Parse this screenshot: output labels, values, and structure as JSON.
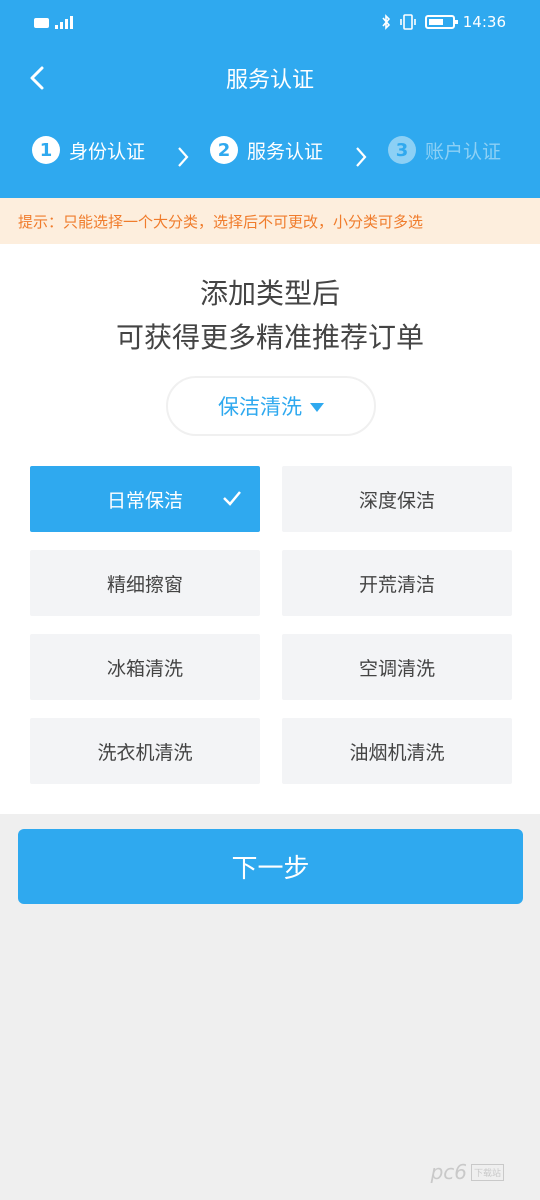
{
  "status_bar": {
    "time": "14:36"
  },
  "nav": {
    "title": "服务认证"
  },
  "steps": [
    {
      "num": "1",
      "label": "身份认证"
    },
    {
      "num": "2",
      "label": "服务认证"
    },
    {
      "num": "3",
      "label": "账户认证"
    }
  ],
  "tip": "提示：只能选择一个大分类，选择后不可更改，小分类可多选",
  "headline": {
    "line1": "添加类型后",
    "line2": "可获得更多精准推荐订单"
  },
  "dropdown": {
    "selected": "保洁清洗"
  },
  "categories": [
    {
      "label": "日常保洁",
      "selected": true
    },
    {
      "label": "深度保洁",
      "selected": false
    },
    {
      "label": "精细擦窗",
      "selected": false
    },
    {
      "label": "开荒清洁",
      "selected": false
    },
    {
      "label": "冰箱清洗",
      "selected": false
    },
    {
      "label": "空调清洗",
      "selected": false
    },
    {
      "label": "洗衣机清洗",
      "selected": false
    },
    {
      "label": "油烟机清洗",
      "selected": false
    }
  ],
  "next_button": "下一步",
  "watermark": {
    "text": "pc6",
    "badge": "下载站"
  },
  "colors": {
    "primary": "#2fa9ef",
    "tip_bg": "#fdeedd",
    "tip_text": "#f07c2c",
    "page_bg": "#efefef"
  }
}
